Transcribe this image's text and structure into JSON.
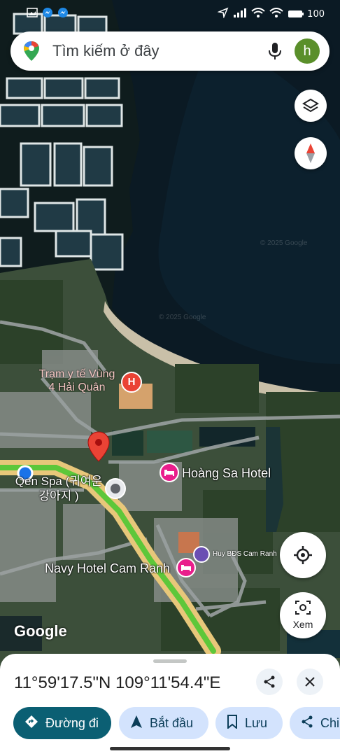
{
  "status_bar": {
    "left_icons": [
      "image-icon",
      "messenger-icon",
      "messenger-icon"
    ],
    "right_icons": [
      "location-arrow-icon",
      "signal-icon",
      "wifi-icon",
      "wifi-icon",
      "battery-icon"
    ],
    "battery_text": "100"
  },
  "search": {
    "placeholder": "Tìm kiếm ở đây",
    "avatar_letter": "h"
  },
  "map": {
    "labels": {
      "medical": "Trạm y tế Vùng\n4 Hải Quân",
      "hoang_sa": "Hoàng Sa Hotel",
      "spa": "Qen Spa (귀여운\n강아지 )",
      "navy": "Navy Hotel Cam Ranh",
      "huy": "Huy BĐS Cam Ranh",
      "watermark": "Google"
    },
    "copyright": "© 2025 Google"
  },
  "buttons": {
    "view": "Xem"
  },
  "sheet": {
    "coordinates": "11°59'17.5\"N 109°11'54.4\"E",
    "actions": {
      "directions": "Đường đi",
      "start": "Bắt đầu",
      "save": "Lưu",
      "share": "Chi"
    }
  },
  "colors": {
    "accent": "#0b5f73",
    "pin": "#ea4335",
    "hotel_pin": "#e91e8c",
    "road_highlight": "#5dc73a"
  }
}
